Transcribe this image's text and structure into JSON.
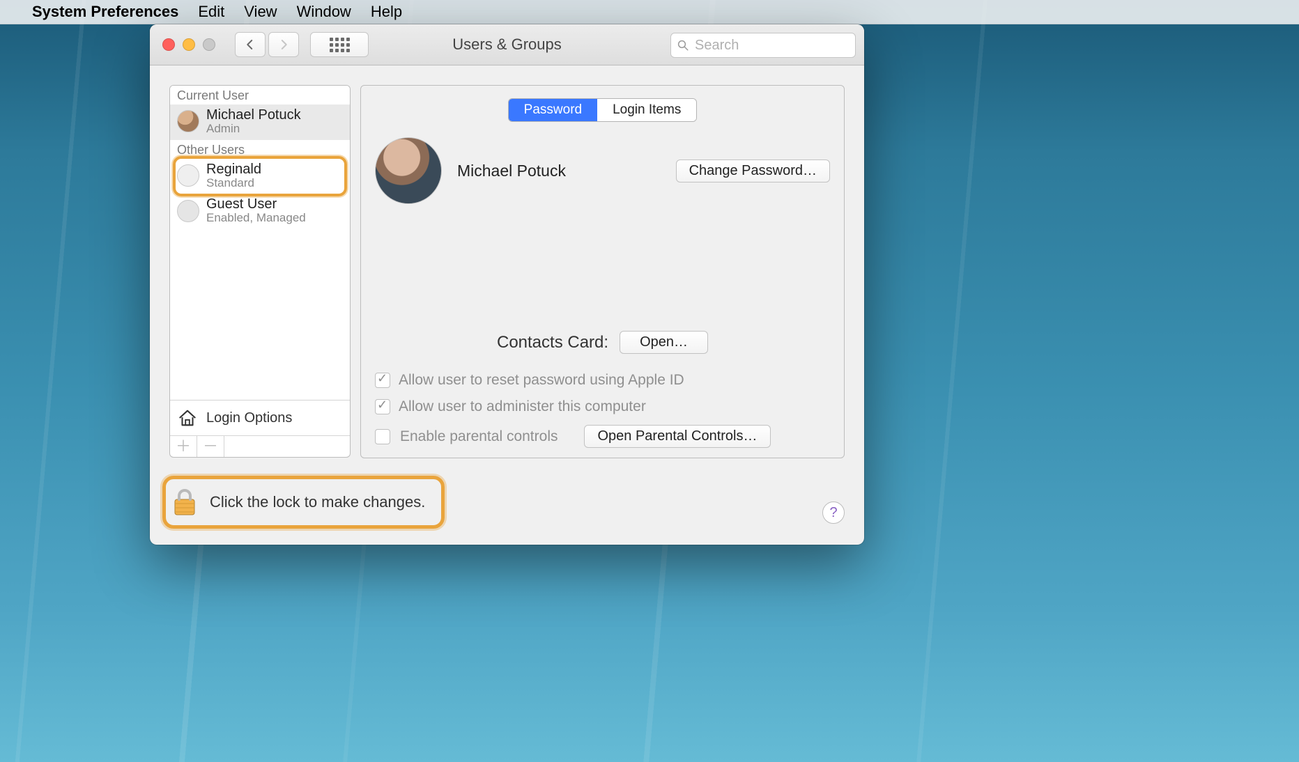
{
  "menubar": {
    "app_name": "System Preferences",
    "items": [
      "Edit",
      "View",
      "Window",
      "Help"
    ]
  },
  "window": {
    "title": "Users & Groups",
    "search_placeholder": "Search"
  },
  "sidebar": {
    "current_user_header": "Current User",
    "other_users_header": "Other Users",
    "current_user": {
      "name": "Michael Potuck",
      "role": "Admin"
    },
    "other_users": [
      {
        "name": "Reginald",
        "role": "Standard",
        "highlighted": true
      },
      {
        "name": "Guest User",
        "role": "Enabled, Managed",
        "highlighted": false
      }
    ],
    "login_options_label": "Login Options"
  },
  "content": {
    "tabs": {
      "password": "Password",
      "login_items": "Login Items",
      "active": "password"
    },
    "display_name": "Michael Potuck",
    "change_password_label": "Change Password…",
    "contacts_card_label": "Contacts Card:",
    "open_button_label": "Open…",
    "allow_reset_apple_id": "Allow user to reset password using Apple ID",
    "allow_administer": "Allow user to administer this computer",
    "enable_parental": "Enable parental controls",
    "open_parental_label": "Open Parental Controls…"
  },
  "footer": {
    "lock_message": "Click the lock to make changes."
  }
}
